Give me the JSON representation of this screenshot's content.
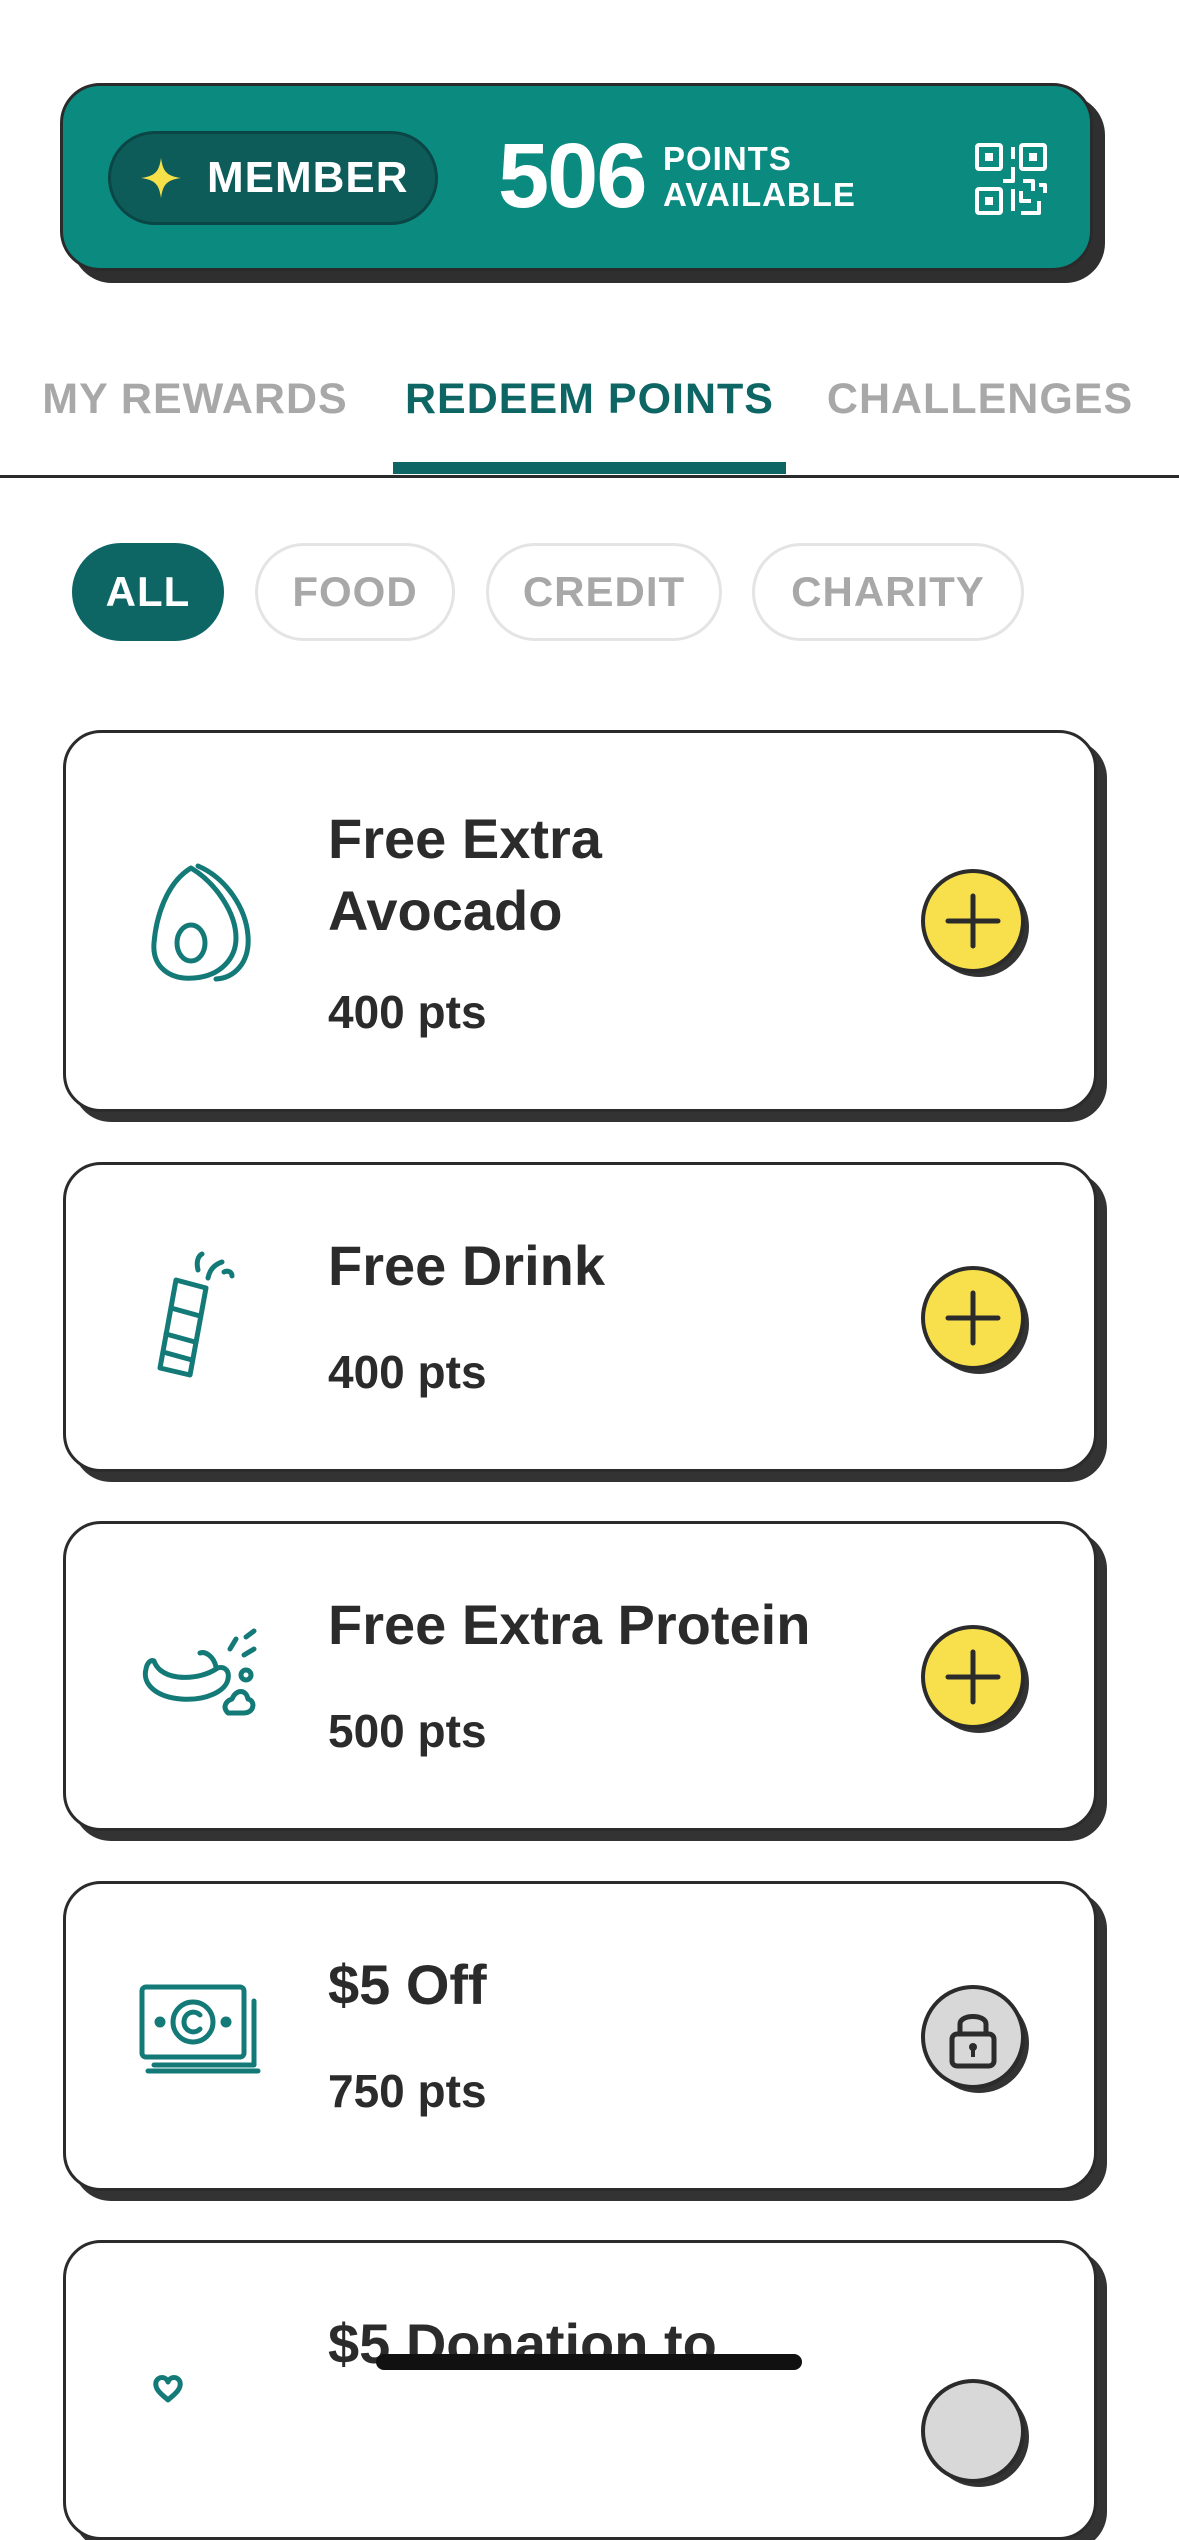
{
  "header": {
    "member_label": "MEMBER",
    "points_value": "506",
    "points_line1": "POINTS",
    "points_line2": "AVAILABLE",
    "qr_icon": "qr-code-icon",
    "star_icon": "sparkle-icon",
    "colors": {
      "card": "#0b8a80",
      "pill": "#0e5c5a",
      "star": "#f5e04a"
    }
  },
  "tabs": [
    {
      "label": "MY REWARDS"
    },
    {
      "label": "REDEEM POINTS",
      "active": true
    },
    {
      "label": "CHALLENGES"
    }
  ],
  "filters": [
    {
      "label": "ALL",
      "active": true
    },
    {
      "label": "FOOD"
    },
    {
      "label": "CREDIT"
    },
    {
      "label": "CHARITY"
    }
  ],
  "rewards": [
    {
      "title_line1": "Free Extra",
      "title_line2": "Avocado",
      "points": "400 pts",
      "icon": "avocado-icon",
      "action": "add-icon"
    },
    {
      "title_line1": "Free Drink",
      "points": "400 pts",
      "icon": "soda-can-icon",
      "action": "add-icon"
    },
    {
      "title_line1": "Free Extra Protein",
      "points": "500 pts",
      "icon": "chicken-icon",
      "action": "add-icon"
    },
    {
      "title_line1": "$5 Off",
      "points": "750 pts",
      "icon": "cash-icon",
      "action": "lock-icon"
    },
    {
      "title_line1": "$5 Donation to",
      "icon": "hand-heart-icon",
      "action": "lock-icon"
    }
  ],
  "colors": {
    "accent": "#0d6664",
    "add_button": "#f7e04b",
    "locked_button": "#d8d8d8"
  }
}
